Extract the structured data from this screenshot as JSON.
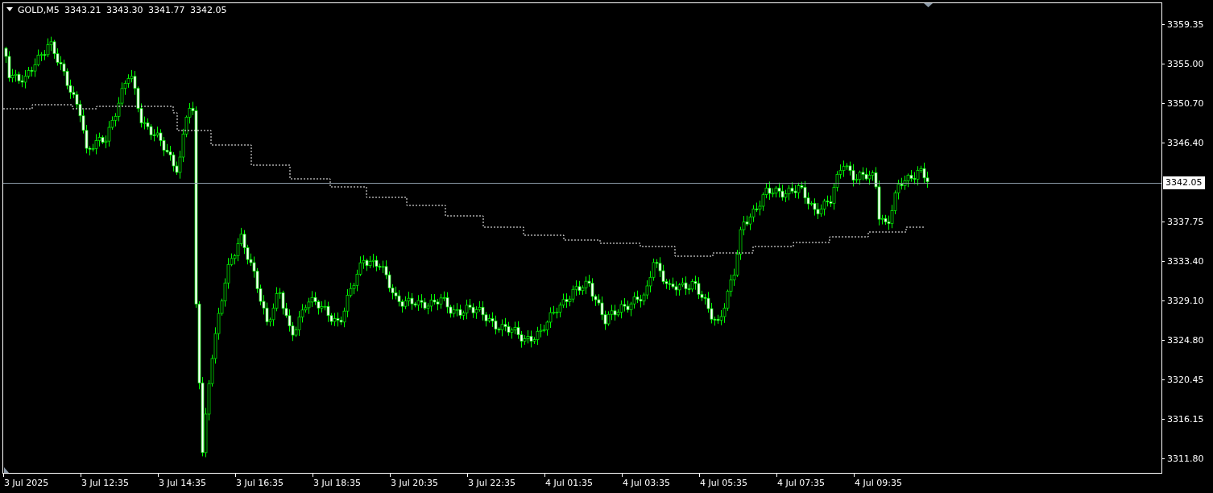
{
  "header": {
    "symbol": "GOLD,M5",
    "open": "3343.21",
    "high": "3343.30",
    "low": "3341.77",
    "close": "3342.05"
  },
  "price_axis": [
    "3359.35",
    "3355.00",
    "3350.70",
    "3346.40",
    "3337.75",
    "3333.40",
    "3329.10",
    "3324.80",
    "3320.45",
    "3316.15",
    "3311.80"
  ],
  "current_price": "3342.05",
  "time_axis": [
    "3 Jul 2025",
    "3 Jul 12:35",
    "3 Jul 14:35",
    "3 Jul 16:35",
    "3 Jul 18:35",
    "3 Jul 20:35",
    "3 Jul 22:35",
    "4 Jul 01:35",
    "4 Jul 03:35",
    "4 Jul 05:35",
    "4 Jul 07:35",
    "4 Jul 09:35"
  ]
}
